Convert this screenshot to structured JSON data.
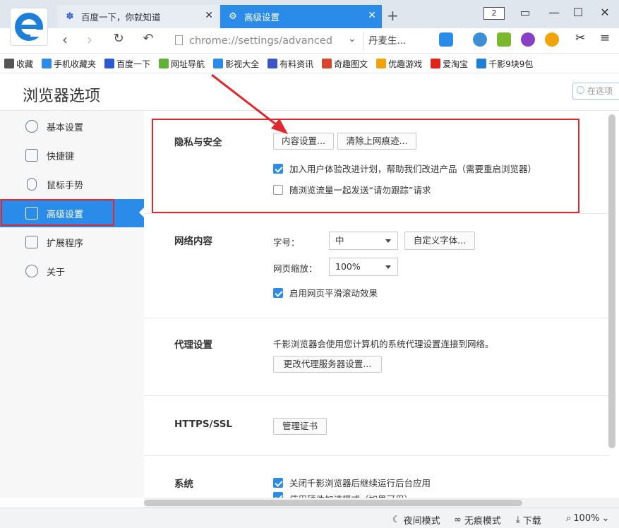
{
  "tabs": [
    {
      "title": "百度一下，你就知道",
      "icon": "paw-icon"
    },
    {
      "title": "高级设置",
      "icon": "gear-icon"
    }
  ],
  "window": {
    "tab_count": "2"
  },
  "address": {
    "url": "chrome://settings/advanced",
    "search_text": "丹麦生..."
  },
  "bookmarks": [
    {
      "label": "收藏",
      "icon": "star-icon",
      "color": "#555555"
    },
    {
      "label": "手机收藏夹",
      "icon": "phone-icon",
      "color": "#2a8ce8"
    },
    {
      "label": "百度一下",
      "icon": "paw-icon",
      "color": "#2a59d1"
    },
    {
      "label": "网址导航",
      "icon": "hao-icon",
      "color": "#5fb236"
    },
    {
      "label": "影视大全",
      "icon": "video-icon",
      "color": "#2a8ce8"
    },
    {
      "label": "有料资讯",
      "icon": "news-icon",
      "color": "#3a55c8"
    },
    {
      "label": "奇趣图文",
      "icon": "fun-icon",
      "color": "#d9442c"
    },
    {
      "label": "优趣游戏",
      "icon": "game-icon",
      "color": "#f2a20a"
    },
    {
      "label": "爱淘宝",
      "icon": "taobao-icon",
      "color": "#e2231a"
    },
    {
      "label": "千影9块9包",
      "icon": "browser-icon",
      "color": "#1e7fd8"
    }
  ],
  "page": {
    "title": "浏览器选项",
    "search_placeholder": "在选项"
  },
  "sidebar": {
    "items": [
      {
        "label": "基本设置",
        "icon": "gear-icon"
      },
      {
        "label": "快捷键",
        "icon": "keyboard-icon"
      },
      {
        "label": "鼠标手势",
        "icon": "mouse-icon"
      },
      {
        "label": "高级设置",
        "icon": "shield-icon"
      },
      {
        "label": "扩展程序",
        "icon": "puzzle-icon"
      },
      {
        "label": "关于",
        "icon": "info-icon"
      }
    ]
  },
  "sections": {
    "privacy": {
      "title": "隐私与安全",
      "content_btn": "内容设置...",
      "clear_btn": "清除上网痕迹...",
      "opt1": "加入用户体验改进计划，帮助我们改进产品（需要重启浏览器）",
      "opt1_checked": true,
      "opt2": "随浏览流量一起发送“请勿跟踪”请求",
      "opt2_checked": false
    },
    "web": {
      "title": "网络内容",
      "font_label": "字号：",
      "font_value": "中",
      "custom_font_btn": "自定义字体...",
      "zoom_label": "网页缩放：",
      "zoom_value": "100%",
      "smooth_scroll": "启用网页平滑滚动效果",
      "smooth_checked": true
    },
    "proxy": {
      "title": "代理设置",
      "desc": "千影浏览器会使用您计算机的系统代理设置连接到网络。",
      "btn": "更改代理服务器设置..."
    },
    "https": {
      "title": "HTTPS/SSL",
      "btn": "管理证书"
    },
    "system": {
      "title": "系统",
      "opt1": "关闭千影浏览器后继续运行后台应用",
      "opt2": "使用硬件加速模式（如果可用）"
    }
  },
  "status": {
    "night": "夜间模式",
    "incognito": "无痕模式",
    "download": "下载",
    "zoom": "100%"
  },
  "colors": {
    "accent": "#2a8ce8",
    "highlight": "#e0282e"
  }
}
